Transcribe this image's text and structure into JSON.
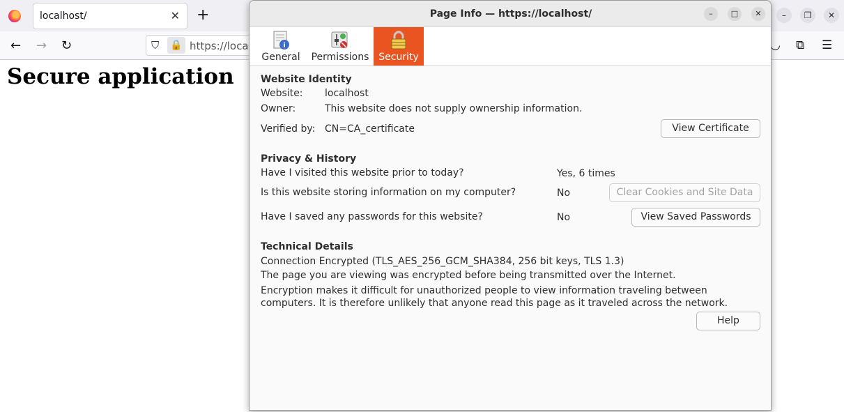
{
  "browser": {
    "tab_title": "localhost/",
    "url_text": "https://local",
    "page_heading": "Secure application"
  },
  "dialog": {
    "title": "Page Info — https://localhost/",
    "tabs": [
      {
        "label": "General"
      },
      {
        "label": "Permissions"
      },
      {
        "label": "Security"
      }
    ],
    "identity": {
      "heading": "Website Identity",
      "website_label": "Website:",
      "website_value": "localhost",
      "owner_label": "Owner:",
      "owner_value": "This website does not supply ownership information.",
      "verified_label": "Verified by:",
      "verified_value": "CN=CA_certificate",
      "view_cert_button": "View Certificate"
    },
    "privacy": {
      "heading": "Privacy & History",
      "visited_q": "Have I visited this website prior to today?",
      "visited_a": "Yes, 6 times",
      "storing_q": "Is this website storing information on my computer?",
      "storing_a": "No",
      "clear_button": "Clear Cookies and Site Data",
      "passwords_q": "Have I saved any passwords for this website?",
      "passwords_a": "No",
      "view_passwords_button": "View Saved Passwords"
    },
    "technical": {
      "heading": "Technical Details",
      "connection": "Connection Encrypted (TLS_AES_256_GCM_SHA384, 256 bit keys, TLS 1.3)",
      "line1": "The page you are viewing was encrypted before being transmitted over the Internet.",
      "line2": "Encryption makes it difficult for unauthorized people to view information traveling between computers. It is therefore unlikely that anyone read this page as it traveled across the network."
    },
    "help_button": "Help"
  },
  "colors": {
    "active_tab": "#e95420"
  }
}
